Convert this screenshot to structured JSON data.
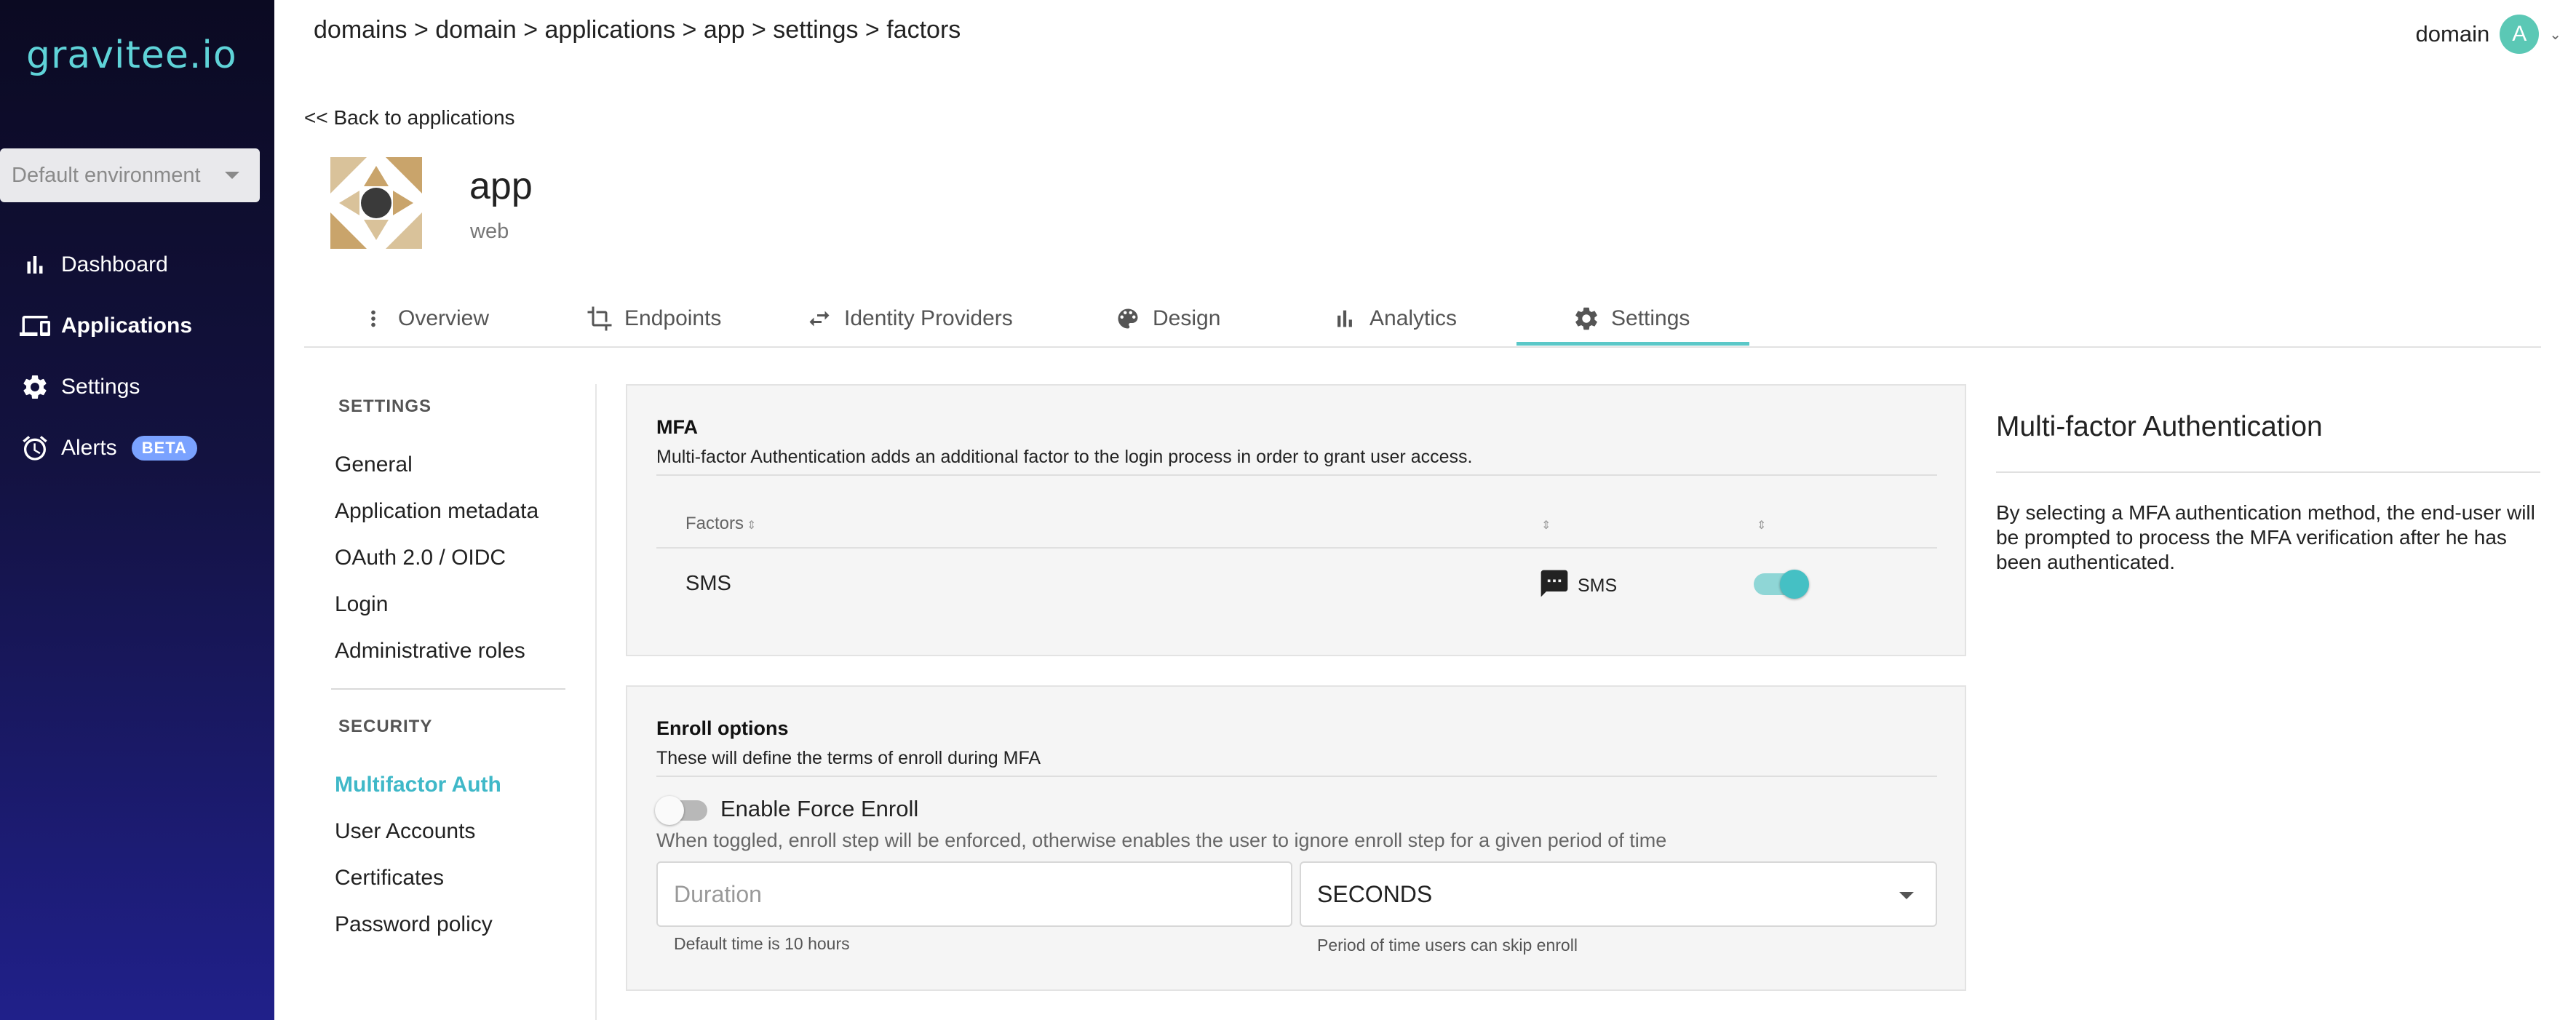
{
  "sidebar": {
    "logo": "gravitee.io",
    "environment": "Default environment",
    "nav": [
      {
        "label": "Dashboard",
        "icon": "bar-chart-icon"
      },
      {
        "label": "Applications",
        "icon": "devices-icon"
      },
      {
        "label": "Settings",
        "icon": "gear-icon"
      },
      {
        "label": "Alerts",
        "icon": "alarm-icon",
        "badge": "BETA"
      }
    ],
    "active": "Applications"
  },
  "header": {
    "breadcrumb": "domains > domain > applications > app > settings > factors",
    "user_name": "domain",
    "avatar_letter": "A"
  },
  "app": {
    "back_link": "<< Back to applications",
    "name": "app",
    "type": "web"
  },
  "tabs": [
    {
      "label": "Overview",
      "icon": "more-vert-icon"
    },
    {
      "label": "Endpoints",
      "icon": "crop-icon"
    },
    {
      "label": "Identity Providers",
      "icon": "swap-icon"
    },
    {
      "label": "Design",
      "icon": "palette-icon"
    },
    {
      "label": "Analytics",
      "icon": "bar-chart-icon"
    },
    {
      "label": "Settings",
      "icon": "gear-icon"
    }
  ],
  "active_tab": "Settings",
  "settings_nav": {
    "settings_header": "SETTINGS",
    "settings_items": [
      "General",
      "Application metadata",
      "OAuth 2.0 / OIDC",
      "Login",
      "Administrative roles"
    ],
    "security_header": "SECURITY",
    "security_items": [
      "Multifactor Auth",
      "User Accounts",
      "Certificates",
      "Password policy"
    ],
    "active": "Multifactor Auth"
  },
  "mfa": {
    "title": "MFA",
    "description": "Multi-factor Authentication adds an additional factor to the login process in order to grant user access.",
    "columns": [
      "Factors",
      "",
      ""
    ],
    "rows": [
      {
        "name": "SMS",
        "type": "SMS",
        "type_icon": "sms-icon",
        "enabled": true
      }
    ]
  },
  "enroll": {
    "title": "Enroll options",
    "description": "These will define the terms of enroll during MFA",
    "force_enroll_label": "Enable Force Enroll",
    "force_enroll_enabled": false,
    "force_enroll_help": "When toggled, enroll step will be enforced, otherwise enables the user to ignore enroll step for a given period of time",
    "duration_placeholder": "Duration",
    "duration_hint": "Default time is 10 hours",
    "unit_value": "SECONDS",
    "unit_hint": "Period of time users can skip enroll"
  },
  "help": {
    "title": "Multi-factor Authentication",
    "body": "By selecting a MFA authentication method, the end-user will be prompted to process the MFA verification after he has been authenticated."
  },
  "colors": {
    "accent": "#5bc8c8",
    "active_link": "#3fb8c8",
    "toggle_on_track": "#8fd6d6",
    "toggle_on_knob": "#45c0c4"
  }
}
